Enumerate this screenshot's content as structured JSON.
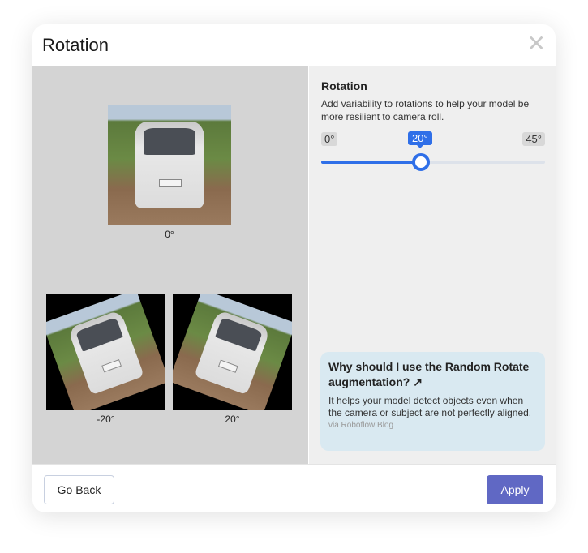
{
  "modal": {
    "title": "Rotation",
    "close_icon": "close-icon"
  },
  "preview": {
    "images": [
      {
        "label": "0°"
      },
      {
        "label": "-20°"
      },
      {
        "label": "20°"
      }
    ]
  },
  "settings": {
    "title": "Rotation",
    "description": "Add variability to rotations to help your model be more resilient to camera roll.",
    "slider": {
      "min_label": "0°",
      "max_label": "45°",
      "value_label": "20°",
      "min": 0,
      "max": 45,
      "value": 20,
      "accent": "#2f6fe8"
    }
  },
  "info_card": {
    "title": "Why should I use the Random Rotate augmentation?",
    "icon": "external-link-icon",
    "body": "It helps your model detect objects even when the camera or subject are not perfectly aligned.",
    "source": "via Roboflow Blog"
  },
  "footer": {
    "back_label": "Go Back",
    "apply_label": "Apply",
    "apply_color": "#6068c4"
  }
}
